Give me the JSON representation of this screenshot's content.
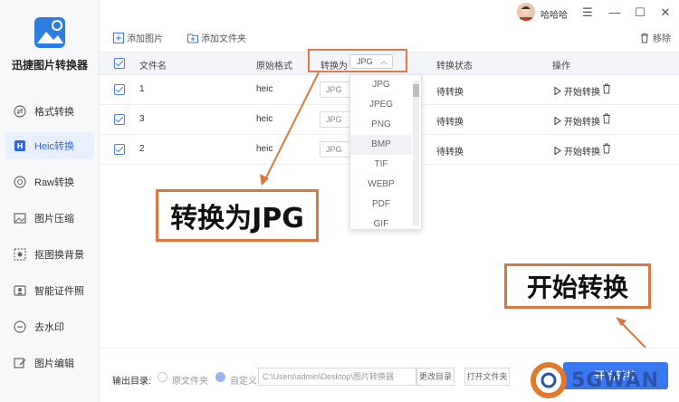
{
  "app": {
    "name": "迅捷图片转换器",
    "brand_color": "#2c6be6"
  },
  "sidebar": {
    "items": [
      {
        "label": "格式转换",
        "icon": "swap-icon",
        "active": false
      },
      {
        "label": "Heic转换",
        "icon": "heic-icon",
        "active": true
      },
      {
        "label": "Raw转换",
        "icon": "raw-icon",
        "active": false
      },
      {
        "label": "图片压缩",
        "icon": "image-compress-icon",
        "active": false
      },
      {
        "label": "抠图换背景",
        "icon": "cutout-icon",
        "active": false
      },
      {
        "label": "智能证件照",
        "icon": "id-photo-icon",
        "active": false
      },
      {
        "label": "去水印",
        "icon": "watermark-remove-icon",
        "active": false
      },
      {
        "label": "图片编辑",
        "icon": "image-edit-icon",
        "active": false
      }
    ]
  },
  "titlebar": {
    "username": "哈哈哈",
    "menu": "☰",
    "minimize": "—",
    "maximize": "☐",
    "close": "✕"
  },
  "toolbar": {
    "add_image": "添加图片",
    "add_folder": "添加文件夹",
    "remove": "移除"
  },
  "table": {
    "headers": {
      "filename": "文件名",
      "original_format": "原始格式",
      "convert_to": "转换为",
      "status": "转换状态",
      "action": "操作"
    },
    "header_select_value": "JPG",
    "rows": [
      {
        "name": "1",
        "format": "heic",
        "target": "JPG",
        "status": "待转换",
        "action": "开始转换"
      },
      {
        "name": "3",
        "format": "heic",
        "target": "JPG",
        "status": "待转换",
        "action": "开始转换"
      },
      {
        "name": "2",
        "format": "heic",
        "target": "JPG",
        "status": "待转换",
        "action": "开始转换"
      }
    ]
  },
  "dropdown": {
    "options": [
      "JPG",
      "JPEG",
      "PNG",
      "BMP",
      "TIF",
      "WEBP",
      "PDF",
      "GIF"
    ],
    "highlighted": "BMP"
  },
  "callouts": {
    "convert_to_jpg": "转换为JPG",
    "start_convert": "开始转换"
  },
  "footer": {
    "output_label": "输出目录:",
    "option_original": "原文件夹",
    "option_custom": "自定义",
    "path": "C:\\Users\\admin\\Desktop\\图片转换器",
    "change_dir": "更改目录",
    "open_folder": "打开文件夹",
    "start_button": "开始转换"
  },
  "watermark": {
    "text": "5GWAN"
  }
}
